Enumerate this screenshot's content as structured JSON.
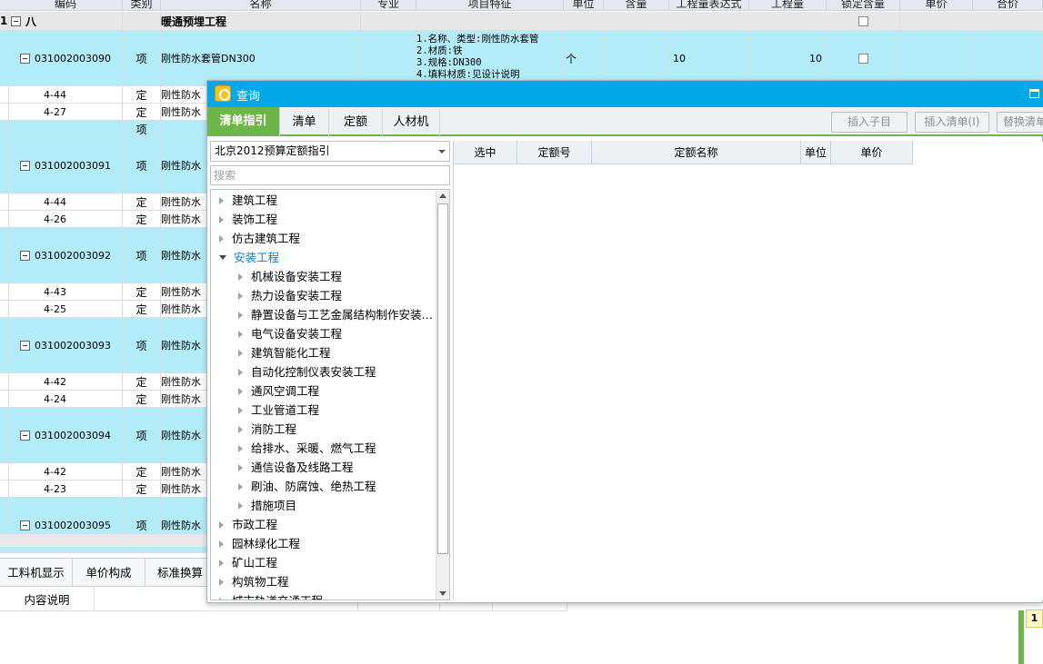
{
  "grid": {
    "columns": [
      "编码",
      "类别",
      "名称",
      "专业",
      "项目特征",
      "单位",
      "含量",
      "工程量表达式",
      "工程量",
      "锁定含量",
      "单价",
      "合价"
    ],
    "section_row": {
      "index": "1",
      "code": "八",
      "name": "暖通预埋工程"
    },
    "rows": [
      {
        "code": "031002003090",
        "type": "项",
        "name": "刚性防水套管DN300",
        "features": "1.名称、类型:刚性防水套管\n2.材质:铁\n3.规格:DN300\n4.填料材质:见设计说明",
        "unit": "个",
        "expr": "10",
        "qty": "10"
      },
      {
        "code": "4-44",
        "type": "定",
        "name": "刚性防水"
      },
      {
        "code": "4-27",
        "type": "定",
        "name": "刚性防水"
      },
      {
        "code": "",
        "type": "项",
        "name": ""
      },
      {
        "code": "031002003091",
        "type": "项",
        "name": "刚性防水"
      },
      {
        "code": "4-44",
        "type": "定",
        "name": "刚性防水"
      },
      {
        "code": "4-26",
        "type": "定",
        "name": "刚性防水"
      },
      {
        "code": "031002003092",
        "type": "项",
        "name": "刚性防水"
      },
      {
        "code": "4-43",
        "type": "定",
        "name": "刚性防水"
      },
      {
        "code": "4-25",
        "type": "定",
        "name": "刚性防水"
      },
      {
        "code": "031002003093",
        "type": "项",
        "name": "刚性防水"
      },
      {
        "code": "4-42",
        "type": "定",
        "name": "刚性防水"
      },
      {
        "code": "4-24",
        "type": "定",
        "name": "刚性防水"
      },
      {
        "code": "031002003094",
        "type": "项",
        "name": "刚性防水"
      },
      {
        "code": "4-42",
        "type": "定",
        "name": "刚性防水"
      },
      {
        "code": "4-23",
        "type": "定",
        "name": "刚性防水"
      },
      {
        "code": "031002003095",
        "type": "项",
        "name": "刚性防水"
      }
    ]
  },
  "bottom_tabs": [
    "工料机显示",
    "单价构成",
    "标准换算"
  ],
  "bottom_row_label": "内容说明",
  "dialog": {
    "title": "查询",
    "tabs": [
      "清单指引",
      "清单",
      "定额",
      "人材机"
    ],
    "buttons": [
      "插入子目",
      "插入清单(I)",
      "替换清单"
    ],
    "library": "北京2012预算定额指引",
    "search_placeholder": "搜索",
    "tree": [
      {
        "label": "建筑工程",
        "level": 0,
        "open": false
      },
      {
        "label": "装饰工程",
        "level": 0,
        "open": false
      },
      {
        "label": "仿古建筑工程",
        "level": 0,
        "open": false
      },
      {
        "label": "安装工程",
        "level": 0,
        "open": true,
        "selected": true
      },
      {
        "label": "机械设备安装工程",
        "level": 1,
        "open": false
      },
      {
        "label": "热力设备安装工程",
        "level": 1,
        "open": false
      },
      {
        "label": "静置设备与工艺金属结构制作安装…",
        "level": 1,
        "open": false
      },
      {
        "label": "电气设备安装工程",
        "level": 1,
        "open": false
      },
      {
        "label": "建筑智能化工程",
        "level": 1,
        "open": false
      },
      {
        "label": "自动化控制仪表安装工程",
        "level": 1,
        "open": false
      },
      {
        "label": "通风空调工程",
        "level": 1,
        "open": false
      },
      {
        "label": "工业管道工程",
        "level": 1,
        "open": false
      },
      {
        "label": "消防工程",
        "level": 1,
        "open": false
      },
      {
        "label": "给排水、采暖、燃气工程",
        "level": 1,
        "open": false
      },
      {
        "label": "通信设备及线路工程",
        "level": 1,
        "open": false
      },
      {
        "label": "刷油、防腐蚀、绝热工程",
        "level": 1,
        "open": false
      },
      {
        "label": "措施项目",
        "level": 1,
        "open": false
      },
      {
        "label": "市政工程",
        "level": 0,
        "open": false
      },
      {
        "label": "园林绿化工程",
        "level": 0,
        "open": false
      },
      {
        "label": "矿山工程",
        "level": 0,
        "open": false
      },
      {
        "label": "构筑物工程",
        "level": 0,
        "open": false
      },
      {
        "label": "城市轨道交通工程",
        "level": 0,
        "open": false
      }
    ],
    "result_columns": [
      "选中",
      "定额号",
      "定额名称",
      "单位",
      "单价"
    ]
  },
  "page_number": "1"
}
